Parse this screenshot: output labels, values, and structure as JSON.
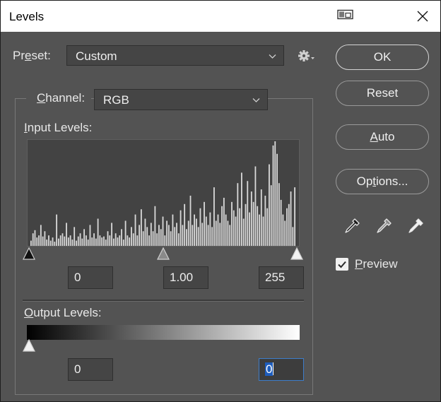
{
  "window": {
    "title": "Levels"
  },
  "preset": {
    "label": "Preset:",
    "value": "Custom"
  },
  "channel": {
    "label": "Channel:",
    "value": "RGB"
  },
  "input_levels": {
    "label": "Input Levels:",
    "black": "0",
    "gamma": "1.00",
    "white": "255"
  },
  "output_levels": {
    "label": "Output Levels:",
    "black": "0",
    "white": "0"
  },
  "buttons": {
    "ok": "OK",
    "reset": "Reset",
    "auto": "Auto",
    "options": "Options..."
  },
  "preview": {
    "label": "Preview",
    "checked": true
  },
  "histogram": {
    "bins": [
      0.05,
      0.12,
      0.15,
      0.08,
      0.1,
      0.2,
      0.09,
      0.14,
      0.06,
      0.1,
      0.05,
      0.08,
      0.04,
      0.3,
      0.07,
      0.1,
      0.12,
      0.09,
      0.22,
      0.08,
      0.1,
      0.06,
      0.18,
      0.05,
      0.09,
      0.12,
      0.07,
      0.16,
      0.1,
      0.06,
      0.2,
      0.08,
      0.12,
      0.07,
      0.26,
      0.1,
      0.08,
      0.09,
      0.06,
      0.14,
      0.1,
      0.22,
      0.07,
      0.12,
      0.08,
      0.1,
      0.16,
      0.06,
      0.24,
      0.1,
      0.08,
      0.18,
      0.12,
      0.3,
      0.1,
      0.2,
      0.35,
      0.14,
      0.26,
      0.18,
      0.1,
      0.22,
      0.14,
      0.38,
      0.12,
      0.2,
      0.16,
      0.28,
      0.1,
      0.24,
      0.2,
      0.14,
      0.3,
      0.18,
      0.22,
      0.12,
      0.34,
      0.2,
      0.4,
      0.16,
      0.24,
      0.48,
      0.2,
      0.3,
      0.26,
      0.18,
      0.36,
      0.22,
      0.42,
      0.28,
      0.2,
      0.32,
      0.18,
      0.56,
      0.24,
      0.3,
      0.22,
      0.38,
      0.46,
      0.3,
      0.24,
      0.2,
      0.42,
      0.34,
      0.28,
      0.6,
      0.36,
      0.7,
      0.26,
      0.4,
      0.62,
      0.32,
      0.52,
      0.42,
      0.76,
      0.38,
      0.3,
      0.54,
      0.28,
      0.48,
      0.36,
      0.78,
      0.58,
      0.96,
      1.0,
      0.88,
      0.6,
      0.44,
      0.3,
      0.24,
      0.36,
      0.4,
      0.52,
      0.18,
      0.56
    ]
  },
  "icons": {
    "snap": "snap-window-icon",
    "close": "close-icon",
    "gear": "gear-icon",
    "dropper_black": "black-eyedropper-icon",
    "dropper_gray": "gray-eyedropper-icon",
    "dropper_white": "white-eyedropper-icon"
  }
}
